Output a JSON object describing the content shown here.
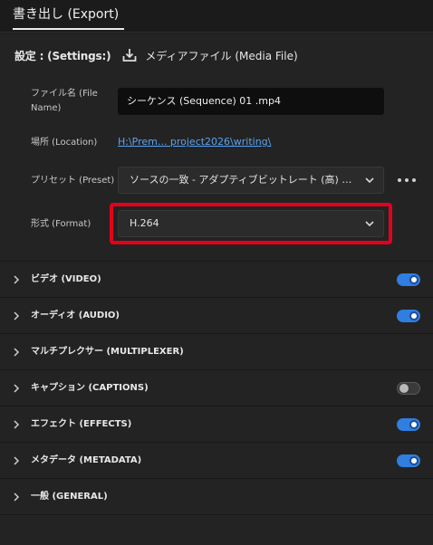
{
  "tab": {
    "label": "書き出し (Export)"
  },
  "settings": {
    "label": "設定 : (Settings:)",
    "destination_icon": "download-to-tray-icon",
    "destination": "メディアファイル (Media File)"
  },
  "fields": {
    "filename": {
      "label_line1": "ファイル名 (File",
      "label_line2": "Name)",
      "value": "シーケンス (Sequence) 01 .mp4"
    },
    "location": {
      "label": "場所 (Location)",
      "value": "H:\\Prem... project2026\\writing\\"
    },
    "preset": {
      "label": "プリセット (Preset)",
      "value": "ソースの一致 - アダプティブビットレート (高) (..."
    },
    "format": {
      "label": "形式 (Format)",
      "value": "H.264"
    }
  },
  "more_icon": "ellipsis-horizontal-icon",
  "colors": {
    "accent": "#2f7ee0",
    "highlight": "#e4001b",
    "link": "#5aa3ef"
  },
  "sections": [
    {
      "title": "ビデオ (VIDEO)",
      "toggle": "on"
    },
    {
      "title": "オーディオ (AUDIO)",
      "toggle": "on"
    },
    {
      "title": "マルチプレクサー (MULTIPLEXER)",
      "toggle": "none"
    },
    {
      "title": "キャプション (CAPTIONS)",
      "toggle": "off"
    },
    {
      "title": "エフェクト (EFFECTS)",
      "toggle": "on"
    },
    {
      "title": "メタデータ (METADATA)",
      "toggle": "on"
    },
    {
      "title": "一般 (GENERAL)",
      "toggle": "none"
    }
  ]
}
